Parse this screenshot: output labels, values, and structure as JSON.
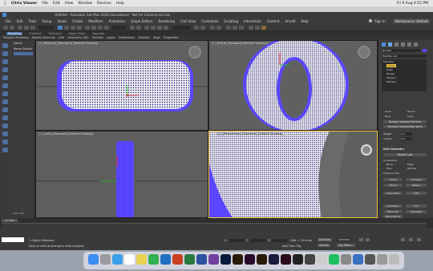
{
  "mac": {
    "app": "Citrix Viewer",
    "menus": [
      "File",
      "Edit",
      "View",
      "Window",
      "Devices",
      "Help"
    ],
    "clock": "Fri 9 Aug  4:55 PM"
  },
  "title": "Untitled - Autodesk 3ds Max 2020 Educational - Not for Commercial Use",
  "signin": "Sign In",
  "workspace": "Workspaces: Default",
  "menus": [
    "File",
    "Edit",
    "Tools",
    "Group",
    "Views",
    "Create",
    "Modifiers",
    "Animation",
    "Graph Editors",
    "Rendering",
    "Civil View",
    "Customize",
    "Scripting",
    "Interactive",
    "Content",
    "Arnold",
    "Help"
  ],
  "ribbon_tabs": [
    "Modeling",
    "Freeform",
    "Selection",
    "Object Paint",
    "Populate"
  ],
  "ribbon_row": [
    "Polygon Modeling",
    "Modify Selection",
    "Edit",
    "Geometry (All)",
    "Vertices",
    "Loops",
    "Subdivision",
    "Visibility",
    "Align",
    "Properties"
  ],
  "scene": {
    "header": "Select",
    "item": "Name (Sorted)"
  },
  "viewports": {
    "top": "[+] [Bottom] [Standard] [Default Shading]",
    "front": "[+] [Front] [Standard] [Default Shading]",
    "left": "[+] [Left] [Standard] [Default Shading]",
    "persp": "[+] [Perspective] [Standard] [Default Shading]"
  },
  "cmd": {
    "object_name": "Box001",
    "modifier_list": "Modifier List",
    "stack": [
      "Edit Poly",
      "Vertex",
      "Edge",
      "Border",
      "Polygon",
      "Element"
    ],
    "buttons": [
      "Grow",
      "Shrink",
      "Ring",
      "Loop"
    ],
    "preview": "Preview Selection",
    "remove_iso": "Remove Isolated Vertices",
    "remove_unused": "Remove Unused Map Verts",
    "weight_label": "Weight",
    "weight_val": "1.0",
    "crease_label": "Crease",
    "crease_val": "0.0",
    "edit_geometry": "Edit Geometry",
    "repeat_last": "Repeat Last",
    "constraints": "Constraints",
    "constraint_opts": [
      "None",
      "Edge",
      "Face",
      "Normal"
    ],
    "preserve_uvs": "Preserve UVs",
    "create": "Create",
    "collapse": "Collapse",
    "attach": "Attach",
    "detach": "Detach",
    "slice_plane": "Slice Plane",
    "split": "Split",
    "quickslice": "QuickSlice",
    "cut": "Cut",
    "msmooth": "MSmooth",
    "tessellate": "Tessellate",
    "make_planar": "Make Planar"
  },
  "timeline": {
    "frame": "0 / 100"
  },
  "status": {
    "selected": "1 Object Selected",
    "hint": "Click or click-and-drag to select objects",
    "x": "X:",
    "y": "Y:",
    "z": "Z:",
    "grid": "Grid = 10.0mm",
    "add_time_tag": "Add Time Tag",
    "autokey": "Auto Key",
    "selected_dd": "Selected",
    "setkey": "Set Key",
    "key_filters": "Key Filters..."
  },
  "zoom_label": "100 / 100",
  "colors": {
    "mesh": "#5a46ff",
    "vertex": "#1a1080",
    "highlight": "#f5c542"
  }
}
